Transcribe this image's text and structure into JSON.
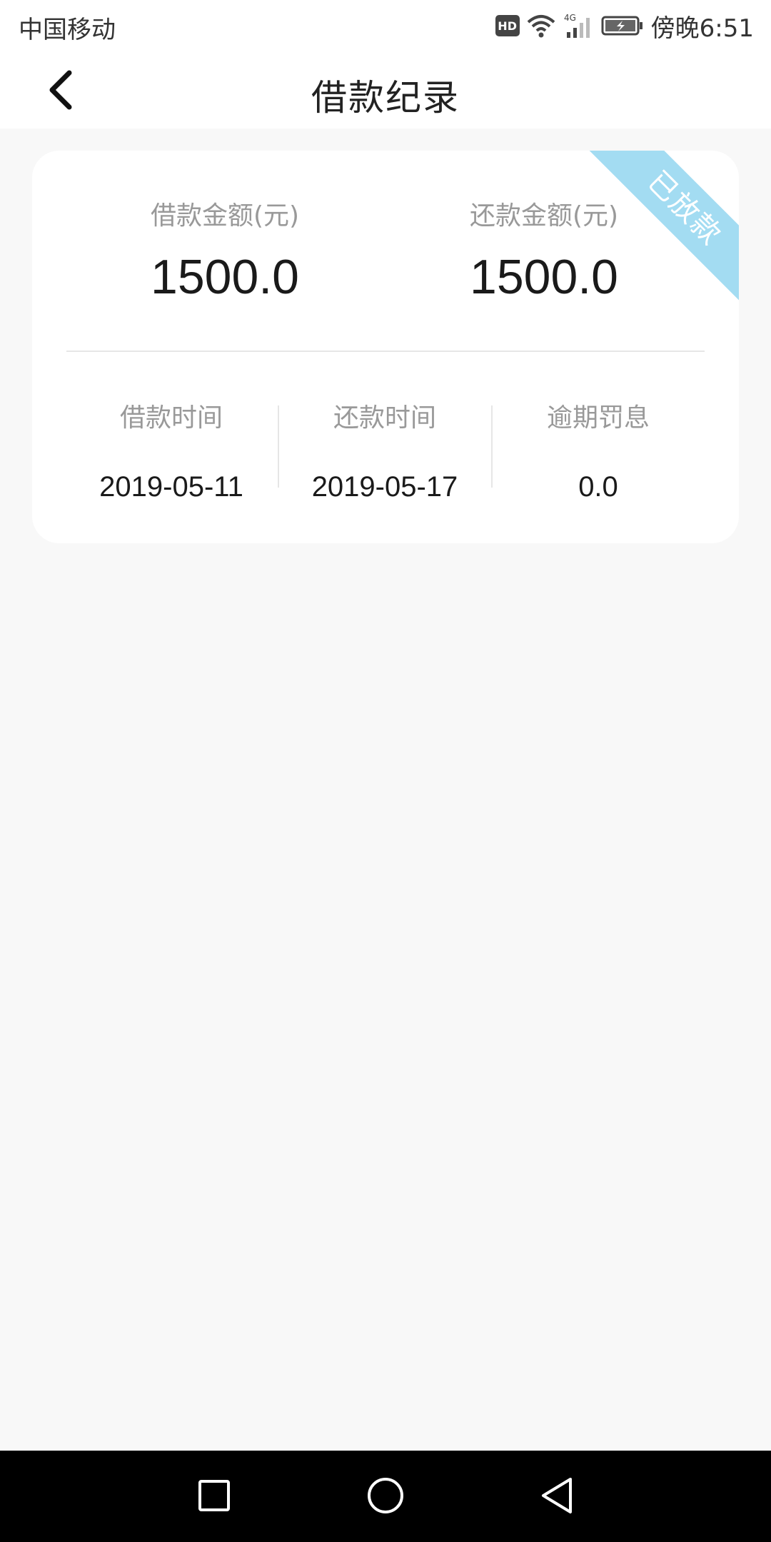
{
  "status_bar": {
    "carrier": "中国移动",
    "hd_label": "HD",
    "network_label": "4G",
    "time": "傍晚6:51"
  },
  "app_bar": {
    "title": "借款纪录"
  },
  "loan_card": {
    "status_ribbon": "已放款",
    "status_color": "#a3dcf2",
    "loan_amount_label": "借款金额(元)",
    "loan_amount": "1500.0",
    "repay_amount_label": "还款金额(元)",
    "repay_amount": "1500.0",
    "loan_date_label": "借款时间",
    "loan_date": "2019-05-11",
    "repay_date_label": "还款时间",
    "repay_date": "2019-05-17",
    "overdue_label": "逾期罚息",
    "overdue_fee": "0.0"
  },
  "icons": {
    "back": "chevron-left-icon",
    "wifi": "wifi-icon",
    "signal": "signal-icon",
    "battery": "battery-charging-icon",
    "nav_recent": "square-icon",
    "nav_home": "circle-icon",
    "nav_back": "triangle-back-icon"
  }
}
